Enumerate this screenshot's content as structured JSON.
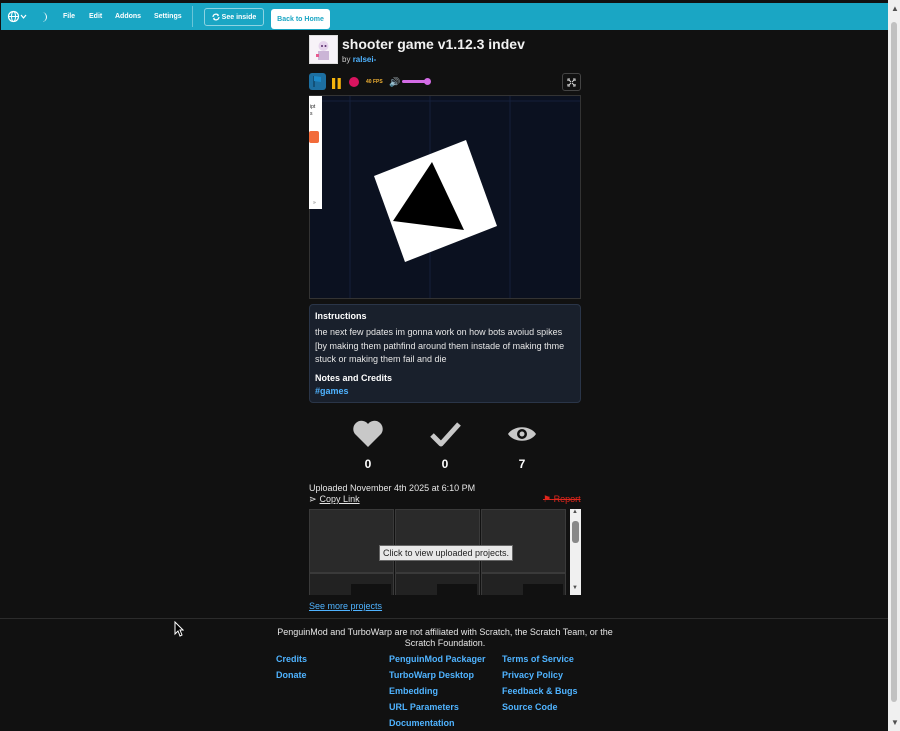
{
  "topbar": {
    "menu": [
      "File",
      "Edit",
      "Addons",
      "Settings"
    ],
    "see_inside": "See inside",
    "back_home": "Back to Home",
    "accent": "#1aa6c4"
  },
  "project": {
    "title": "shooter game v1.12.3 indev",
    "by_prefix": "by",
    "author": "ralsei-",
    "fps": "40 FPS"
  },
  "side_widget_text": [
    "ipt",
    "s"
  ],
  "instructions": {
    "heading": "Instructions",
    "body": "the next few pdates im gonna work on how bots avoiud spikes [by making them pathfind around them instade of making thme stuck or making them fail and die",
    "notes_heading": "Notes and Credits",
    "tag": "#games"
  },
  "stats": {
    "loves": "0",
    "favorites": "0",
    "views": "7"
  },
  "meta": {
    "uploaded": "Uploaded November 4th 2025 at 6:10 PM",
    "copy_link": "Copy Link",
    "report": "Report"
  },
  "remix_grid": {
    "tooltip": "Click to view uploaded projects.",
    "see_more": "See more projects"
  },
  "footer": {
    "disclaimer": "PenguinMod and TurboWarp are not affiliated with Scratch, the Scratch Team, or the Scratch Foundation.",
    "col1": [
      "Credits",
      "Donate"
    ],
    "col2": [
      "PenguinMod Packager",
      "TurboWarp Desktop",
      "Embedding",
      "URL Parameters",
      "Documentation"
    ],
    "col3": [
      "Terms of Service",
      "Privacy Policy",
      "Feedback & Bugs",
      "Source Code"
    ]
  }
}
